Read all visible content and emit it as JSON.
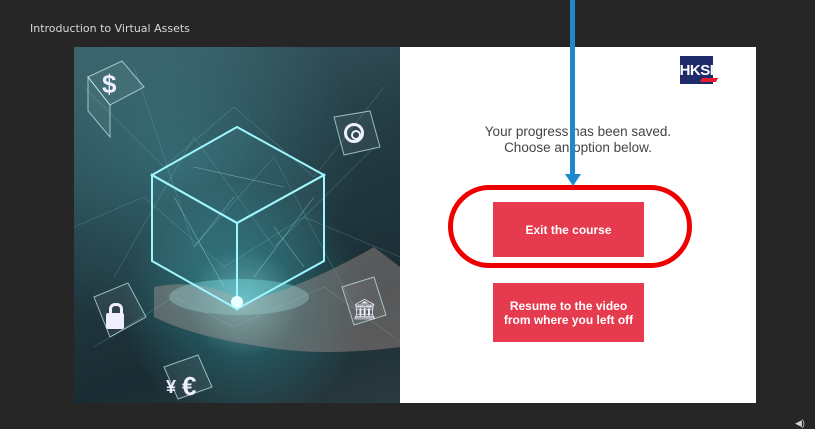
{
  "window": {
    "course_title": "Introduction to Virtual Assets"
  },
  "slide": {
    "logo_text": "HKSI",
    "message_line1": "Your progress has been saved.",
    "message_line2": "Choose an option below.",
    "exit_button_label": "Exit the course",
    "resume_button_line1": "Resume to the video",
    "resume_button_line2": "from where you left off"
  },
  "hero_icons": {
    "dollar": "$",
    "euro": "€",
    "yen": "¥"
  },
  "colors": {
    "background": "#262626",
    "button": "#e63b4e",
    "highlight": "#ee0000",
    "arrow": "#1d8ad0",
    "logo": "#1f2a6b"
  },
  "icons": [
    "dollar-icon",
    "target-icon",
    "lock-icon",
    "bank-icon",
    "euro-icon",
    "yen-icon",
    "volume-icon"
  ]
}
